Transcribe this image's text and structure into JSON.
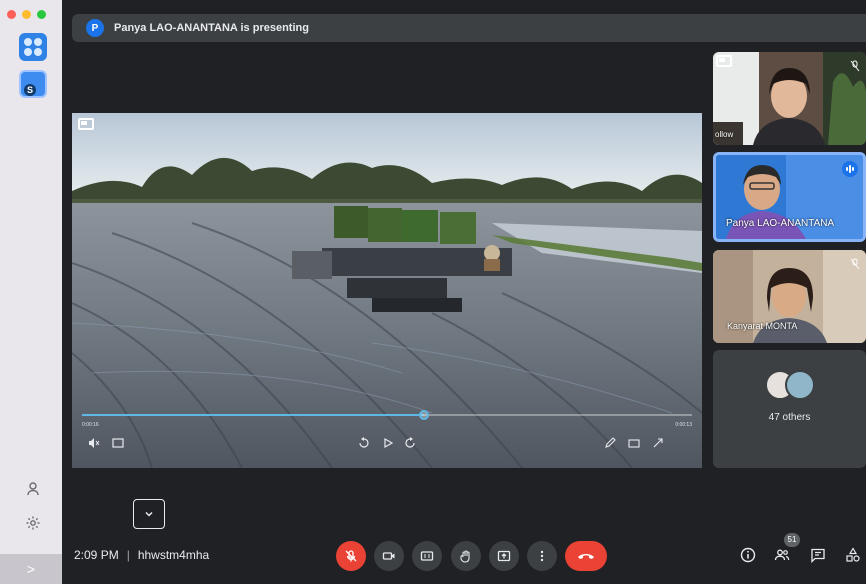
{
  "window": {
    "traffic_lights": [
      "close",
      "minimize",
      "zoom"
    ]
  },
  "rail": {
    "apps": [
      "windows-app-icon",
      "skype-app-icon"
    ],
    "bottom_icons": [
      "person-icon",
      "gear-icon"
    ],
    "expand_glyph": ">"
  },
  "banner": {
    "avatar_initial": "P",
    "text": "Panya LAO-ANANTANA is presenting"
  },
  "presentation": {
    "video_elapsed": "0:00:16",
    "video_remaining": "0:00:13",
    "progress_fraction": 0.56
  },
  "participants": [
    {
      "name": "",
      "partial_label": "ollow",
      "muted": true
    },
    {
      "name": "Panya LAO-ANANTANA",
      "speaking": true
    },
    {
      "name": "Kanyarat MONTA",
      "muted": true
    }
  ],
  "others": {
    "label": "47 others"
  },
  "meeting": {
    "time": "2:09 PM",
    "separator": "|",
    "code": "hhwstm4mha"
  },
  "controls": {
    "people_count": "51"
  },
  "colors": {
    "background": "#202124",
    "tile": "#3c4043",
    "danger": "#ea4335",
    "accent": "#1a73e8",
    "rail": "#e9e6ec"
  }
}
